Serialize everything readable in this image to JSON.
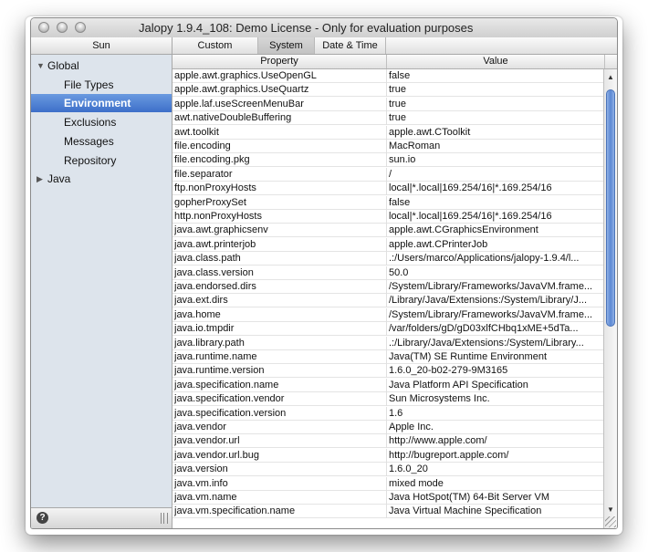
{
  "window": {
    "title": "Jalopy 1.9.4_108:  Demo License - Only for evaluation purposes"
  },
  "sidebar": {
    "header": "Sun",
    "items": [
      {
        "label": "Global",
        "expanded": true,
        "level": 0
      },
      {
        "label": "File Types",
        "level": 1
      },
      {
        "label": "Environment",
        "level": 1,
        "selected": true
      },
      {
        "label": "Exclusions",
        "level": 1
      },
      {
        "label": "Messages",
        "level": 1
      },
      {
        "label": "Repository",
        "level": 1
      },
      {
        "label": "Java",
        "expanded": false,
        "level": 0
      }
    ],
    "help_label": "?"
  },
  "tabs": [
    {
      "label": "Custom"
    },
    {
      "label": "System",
      "active": true
    },
    {
      "label": "Date & Time"
    }
  ],
  "table": {
    "columns": [
      "Property",
      "Value"
    ],
    "rows": [
      [
        "apple.awt.graphics.UseOpenGL",
        "false"
      ],
      [
        "apple.awt.graphics.UseQuartz",
        "true"
      ],
      [
        "apple.laf.useScreenMenuBar",
        "true"
      ],
      [
        "awt.nativeDoubleBuffering",
        "true"
      ],
      [
        "awt.toolkit",
        "apple.awt.CToolkit"
      ],
      [
        "file.encoding",
        "MacRoman"
      ],
      [
        "file.encoding.pkg",
        "sun.io"
      ],
      [
        "file.separator",
        "/"
      ],
      [
        "ftp.nonProxyHosts",
        "local|*.local|169.254/16|*.169.254/16"
      ],
      [
        "gopherProxySet",
        "false"
      ],
      [
        "http.nonProxyHosts",
        "local|*.local|169.254/16|*.169.254/16"
      ],
      [
        "java.awt.graphicsenv",
        "apple.awt.CGraphicsEnvironment"
      ],
      [
        "java.awt.printerjob",
        "apple.awt.CPrinterJob"
      ],
      [
        "java.class.path",
        ".:/Users/marco/Applications/jalopy-1.9.4/l..."
      ],
      [
        "java.class.version",
        "50.0"
      ],
      [
        "java.endorsed.dirs",
        "/System/Library/Frameworks/JavaVM.frame..."
      ],
      [
        "java.ext.dirs",
        "/Library/Java/Extensions:/System/Library/J..."
      ],
      [
        "java.home",
        "/System/Library/Frameworks/JavaVM.frame..."
      ],
      [
        "java.io.tmpdir",
        "/var/folders/gD/gD03xlfCHbq1xME+5dTa..."
      ],
      [
        "java.library.path",
        ".:/Library/Java/Extensions:/System/Library..."
      ],
      [
        "java.runtime.name",
        "Java(TM) SE Runtime Environment"
      ],
      [
        "java.runtime.version",
        "1.6.0_20-b02-279-9M3165"
      ],
      [
        "java.specification.name",
        "Java Platform API Specification"
      ],
      [
        "java.specification.vendor",
        "Sun Microsystems Inc."
      ],
      [
        "java.specification.version",
        "1.6"
      ],
      [
        "java.vendor",
        "Apple Inc."
      ],
      [
        "java.vendor.url",
        "http://www.apple.com/"
      ],
      [
        "java.vendor.url.bug",
        "http://bugreport.apple.com/"
      ],
      [
        "java.version",
        "1.6.0_20"
      ],
      [
        "java.vm.info",
        "mixed mode"
      ],
      [
        "java.vm.name",
        "Java HotSpot(TM) 64-Bit Server VM"
      ],
      [
        "java.vm.specification.name",
        "Java Virtual Machine Specification"
      ]
    ]
  }
}
